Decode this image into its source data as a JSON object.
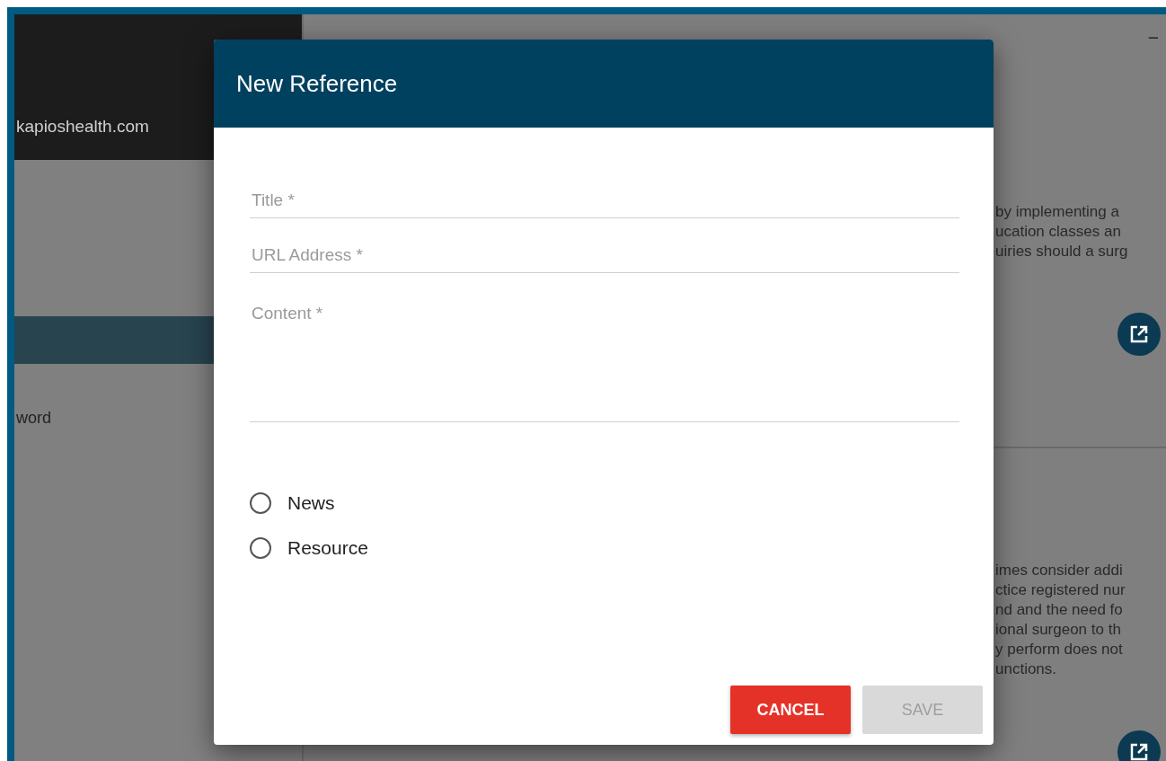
{
  "sidebar": {
    "account_text": "kapioshealth.com",
    "items": [
      {
        "selected": true
      },
      {
        "label": "word",
        "selected": false
      }
    ]
  },
  "main": {
    "header_mark": "−",
    "cards": [
      {
        "lines": [
          "by implementing a",
          "ucation classes an",
          "uiries should a surg"
        ]
      },
      {
        "lines": [
          "imes consider addi",
          "ctice registered nur",
          "nd and the need fo",
          "ional surgeon to th",
          "y perform does not",
          "unctions."
        ]
      }
    ]
  },
  "dialog": {
    "title": "New Reference",
    "fields": [
      {
        "kind": "input",
        "placeholder": "Title *"
      },
      {
        "kind": "input",
        "placeholder": "URL Address *"
      },
      {
        "kind": "textarea",
        "placeholder": "Content *"
      }
    ],
    "radios": [
      {
        "label": "News",
        "selected": false
      },
      {
        "label": "Resource",
        "selected": false
      }
    ],
    "buttons": [
      {
        "label": "CANCEL",
        "kind": "cancel",
        "disabled": false
      },
      {
        "label": "SAVE",
        "kind": "save",
        "disabled": true
      }
    ]
  }
}
